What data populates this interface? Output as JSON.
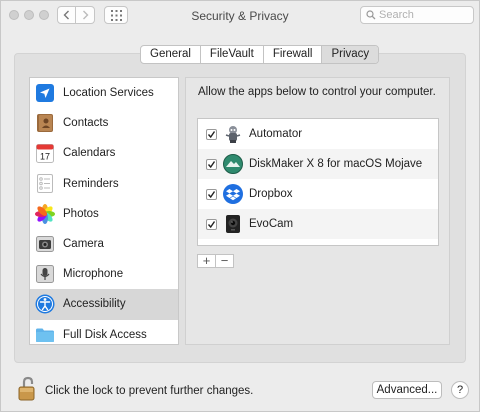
{
  "window": {
    "title": "Security & Privacy",
    "search_placeholder": "Search"
  },
  "tabs": [
    {
      "label": "General"
    },
    {
      "label": "FileVault"
    },
    {
      "label": "Firewall"
    },
    {
      "label": "Privacy",
      "selected": true
    }
  ],
  "sidebar": {
    "items": [
      {
        "label": "Location Services",
        "icon": "location-arrow-icon"
      },
      {
        "label": "Contacts",
        "icon": "contacts-book-icon"
      },
      {
        "label": "Calendars",
        "icon": "calendar-icon",
        "icon_text": "17"
      },
      {
        "label": "Reminders",
        "icon": "reminders-icon"
      },
      {
        "label": "Photos",
        "icon": "photos-flower-icon"
      },
      {
        "label": "Camera",
        "icon": "camera-icon"
      },
      {
        "label": "Microphone",
        "icon": "microphone-icon"
      },
      {
        "label": "Accessibility",
        "icon": "accessibility-icon",
        "selected": true
      },
      {
        "label": "Full Disk Access",
        "icon": "folder-icon"
      }
    ]
  },
  "main": {
    "heading": "Allow the apps below to control your computer.",
    "apps": [
      {
        "label": "Automator",
        "checked": true,
        "icon": "automator-robot-icon"
      },
      {
        "label": "DiskMaker X 8 for macOS Mojave",
        "checked": true,
        "icon": "diskmaker-icon"
      },
      {
        "label": "Dropbox",
        "checked": true,
        "icon": "dropbox-icon"
      },
      {
        "label": "EvoCam",
        "checked": true,
        "icon": "evocam-icon"
      }
    ],
    "add_label": "+",
    "remove_label": "−"
  },
  "footer": {
    "lock_text": "Click the lock to prevent further changes.",
    "advanced_label": "Advanced...",
    "help_label": "?"
  },
  "colors": {
    "window_bg": "#ececec",
    "selected_row": "#d7d7d7",
    "accent_blue": "#1a73e8"
  }
}
